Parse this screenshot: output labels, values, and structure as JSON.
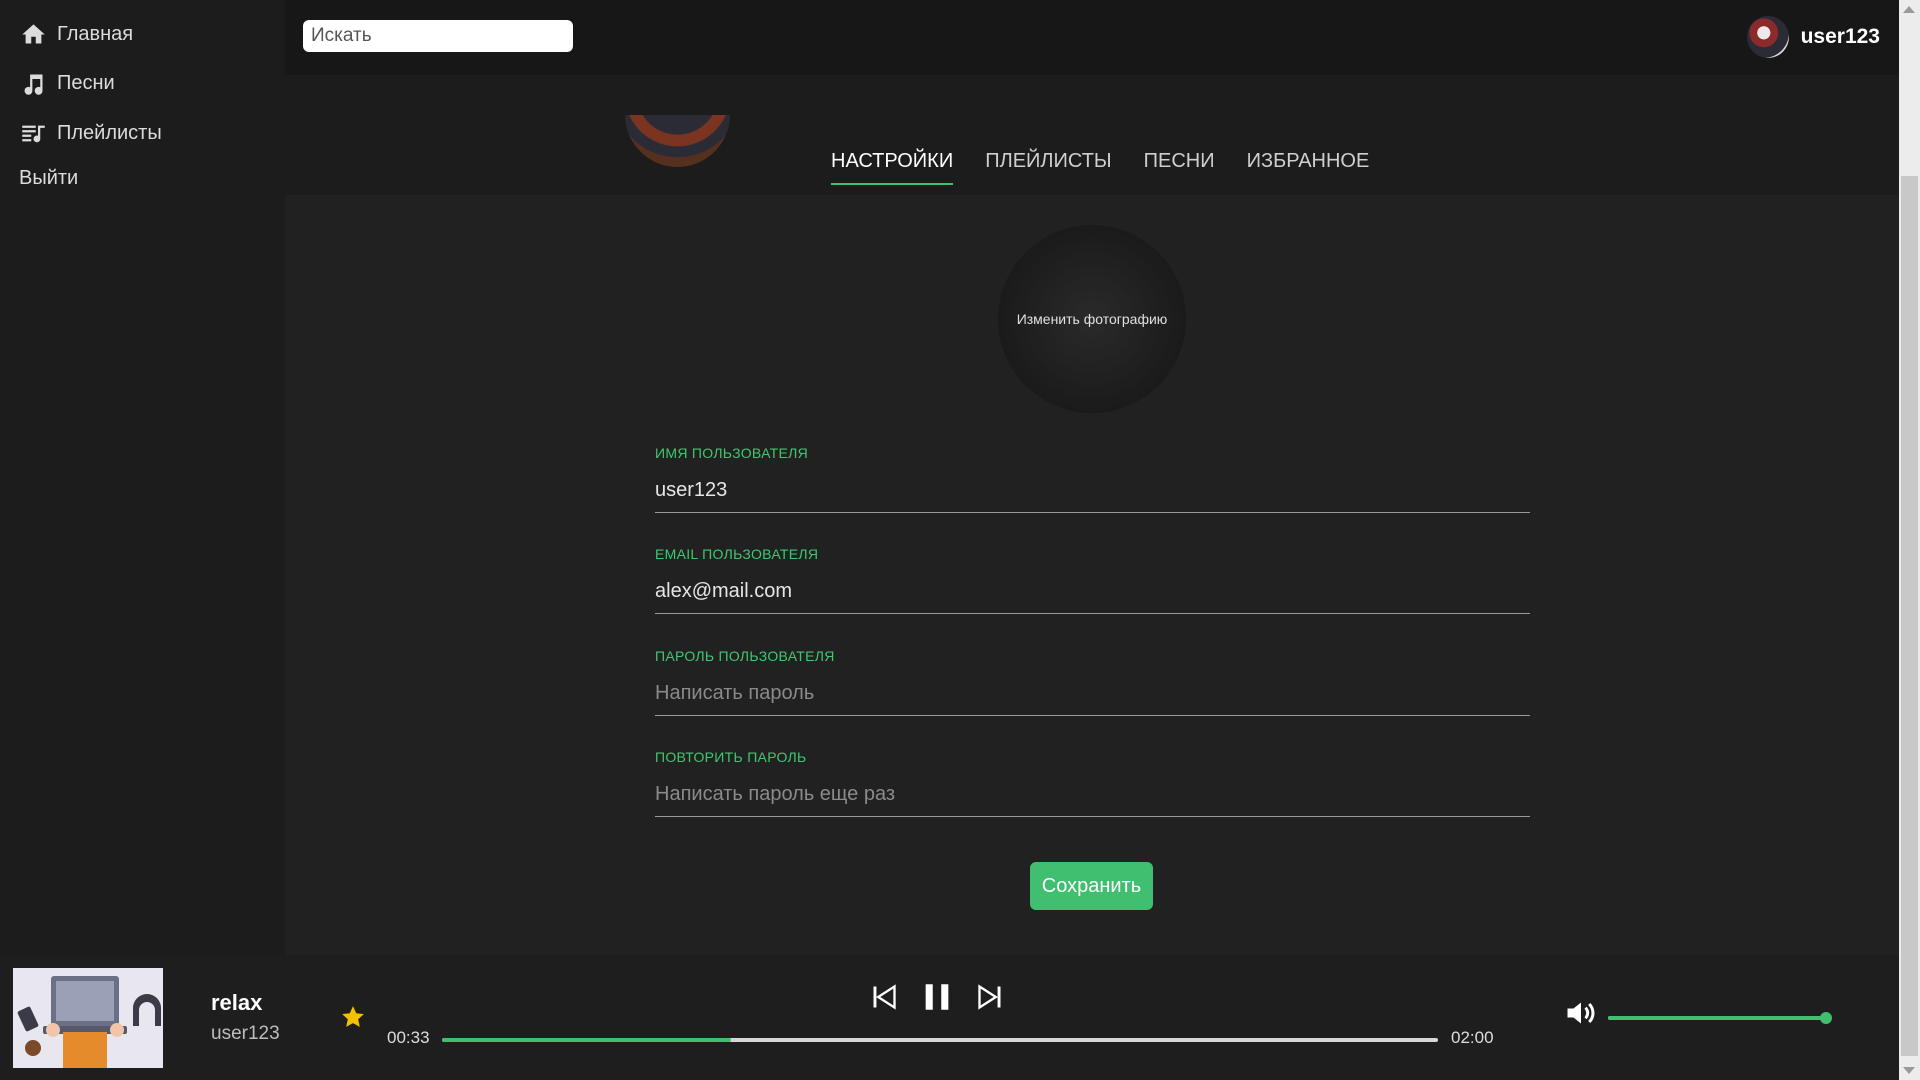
{
  "sidebar": {
    "items": [
      {
        "label": "Главная",
        "icon": "home-icon"
      },
      {
        "label": "Песни",
        "icon": "music-note-icon"
      },
      {
        "label": "Плейлисты",
        "icon": "playlist-icon"
      }
    ],
    "logout_label": "Выйти"
  },
  "header": {
    "search_placeholder": "Искать",
    "username": "user123"
  },
  "tabs": [
    {
      "label": "НАСТРОЙКИ",
      "active": true
    },
    {
      "label": "ПЛЕЙЛИСТЫ",
      "active": false
    },
    {
      "label": "ПЕСНИ",
      "active": false
    },
    {
      "label": "ИЗБРАННОЕ",
      "active": false
    }
  ],
  "settings": {
    "change_photo_label": "Изменить фотографию",
    "fields": [
      {
        "label": "ИМЯ ПОЛЬЗОВАТЕЛЯ",
        "value": "user123",
        "placeholder": ""
      },
      {
        "label": "EMAIL ПОЛЬЗОВАТЕЛЯ",
        "value": "alex@mail.com",
        "placeholder": ""
      },
      {
        "label": "ПАРОЛЬ ПОЛЬЗОВАТЕЛЯ",
        "value": "",
        "placeholder": "Написать пароль"
      },
      {
        "label": "ПОВТОРИТЬ ПАРОЛЬ",
        "value": "",
        "placeholder": "Написать пароль еще раз"
      }
    ],
    "save_label": "Сохранить"
  },
  "player": {
    "title": "relax",
    "artist": "user123",
    "current_time": "00:33",
    "total_time": "02:00",
    "progress": 0.29,
    "volume": 1.0,
    "is_favorite": true,
    "accent_color": "#3fbf6f",
    "star_color": "#f2c200"
  }
}
